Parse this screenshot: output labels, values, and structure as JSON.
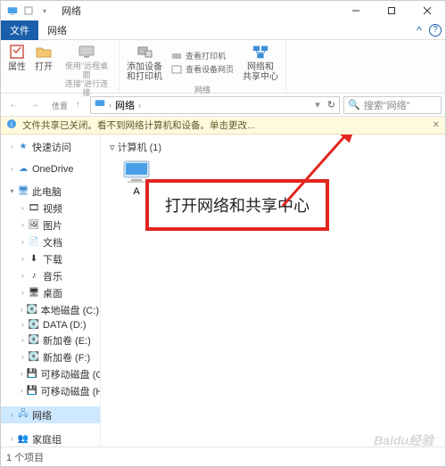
{
  "title": "网络",
  "tabs": {
    "file": "文件",
    "network": "网络"
  },
  "ribbon": {
    "properties": "属性",
    "open": "打开",
    "open_sub": "使用\"远程桌面\n连接\"进行连接",
    "add_device": "添加设备\n和打印机",
    "small_1": "查看打印机",
    "small_2": "查看设备网页",
    "net_center": "网络和\n共享中心",
    "group_location": "位置",
    "group_network": "网络"
  },
  "address": {
    "path": "网络",
    "refresh": "↻"
  },
  "search": {
    "placeholder": "搜索\"网络\""
  },
  "infobar": {
    "text": "文件共享已关闭。看不到网络计算机和设备。单击更改..."
  },
  "content": {
    "section": "▿ 计算机 (1)",
    "computer_name": "A",
    "callout": "打开网络和共享中心"
  },
  "tree": {
    "quick": "快速访问",
    "onedrive": "OneDrive",
    "thispc": "此电脑",
    "video": "视频",
    "pictures": "图片",
    "docs": "文档",
    "downloads": "下载",
    "music": "音乐",
    "desktop": "桌面",
    "cdrive": "本地磁盘 (C:)",
    "ddrive": "DATA (D:)",
    "edrive": "新加卷 (E:)",
    "fdrive": "新加卷 (F:)",
    "gdrive": "可移动磁盘 (G:)",
    "hdrive": "可移动磁盘 (H:)",
    "network": "网络",
    "homegroup": "家庭组"
  },
  "status": {
    "items": "1 个项目"
  },
  "watermark": "Baidu经验"
}
